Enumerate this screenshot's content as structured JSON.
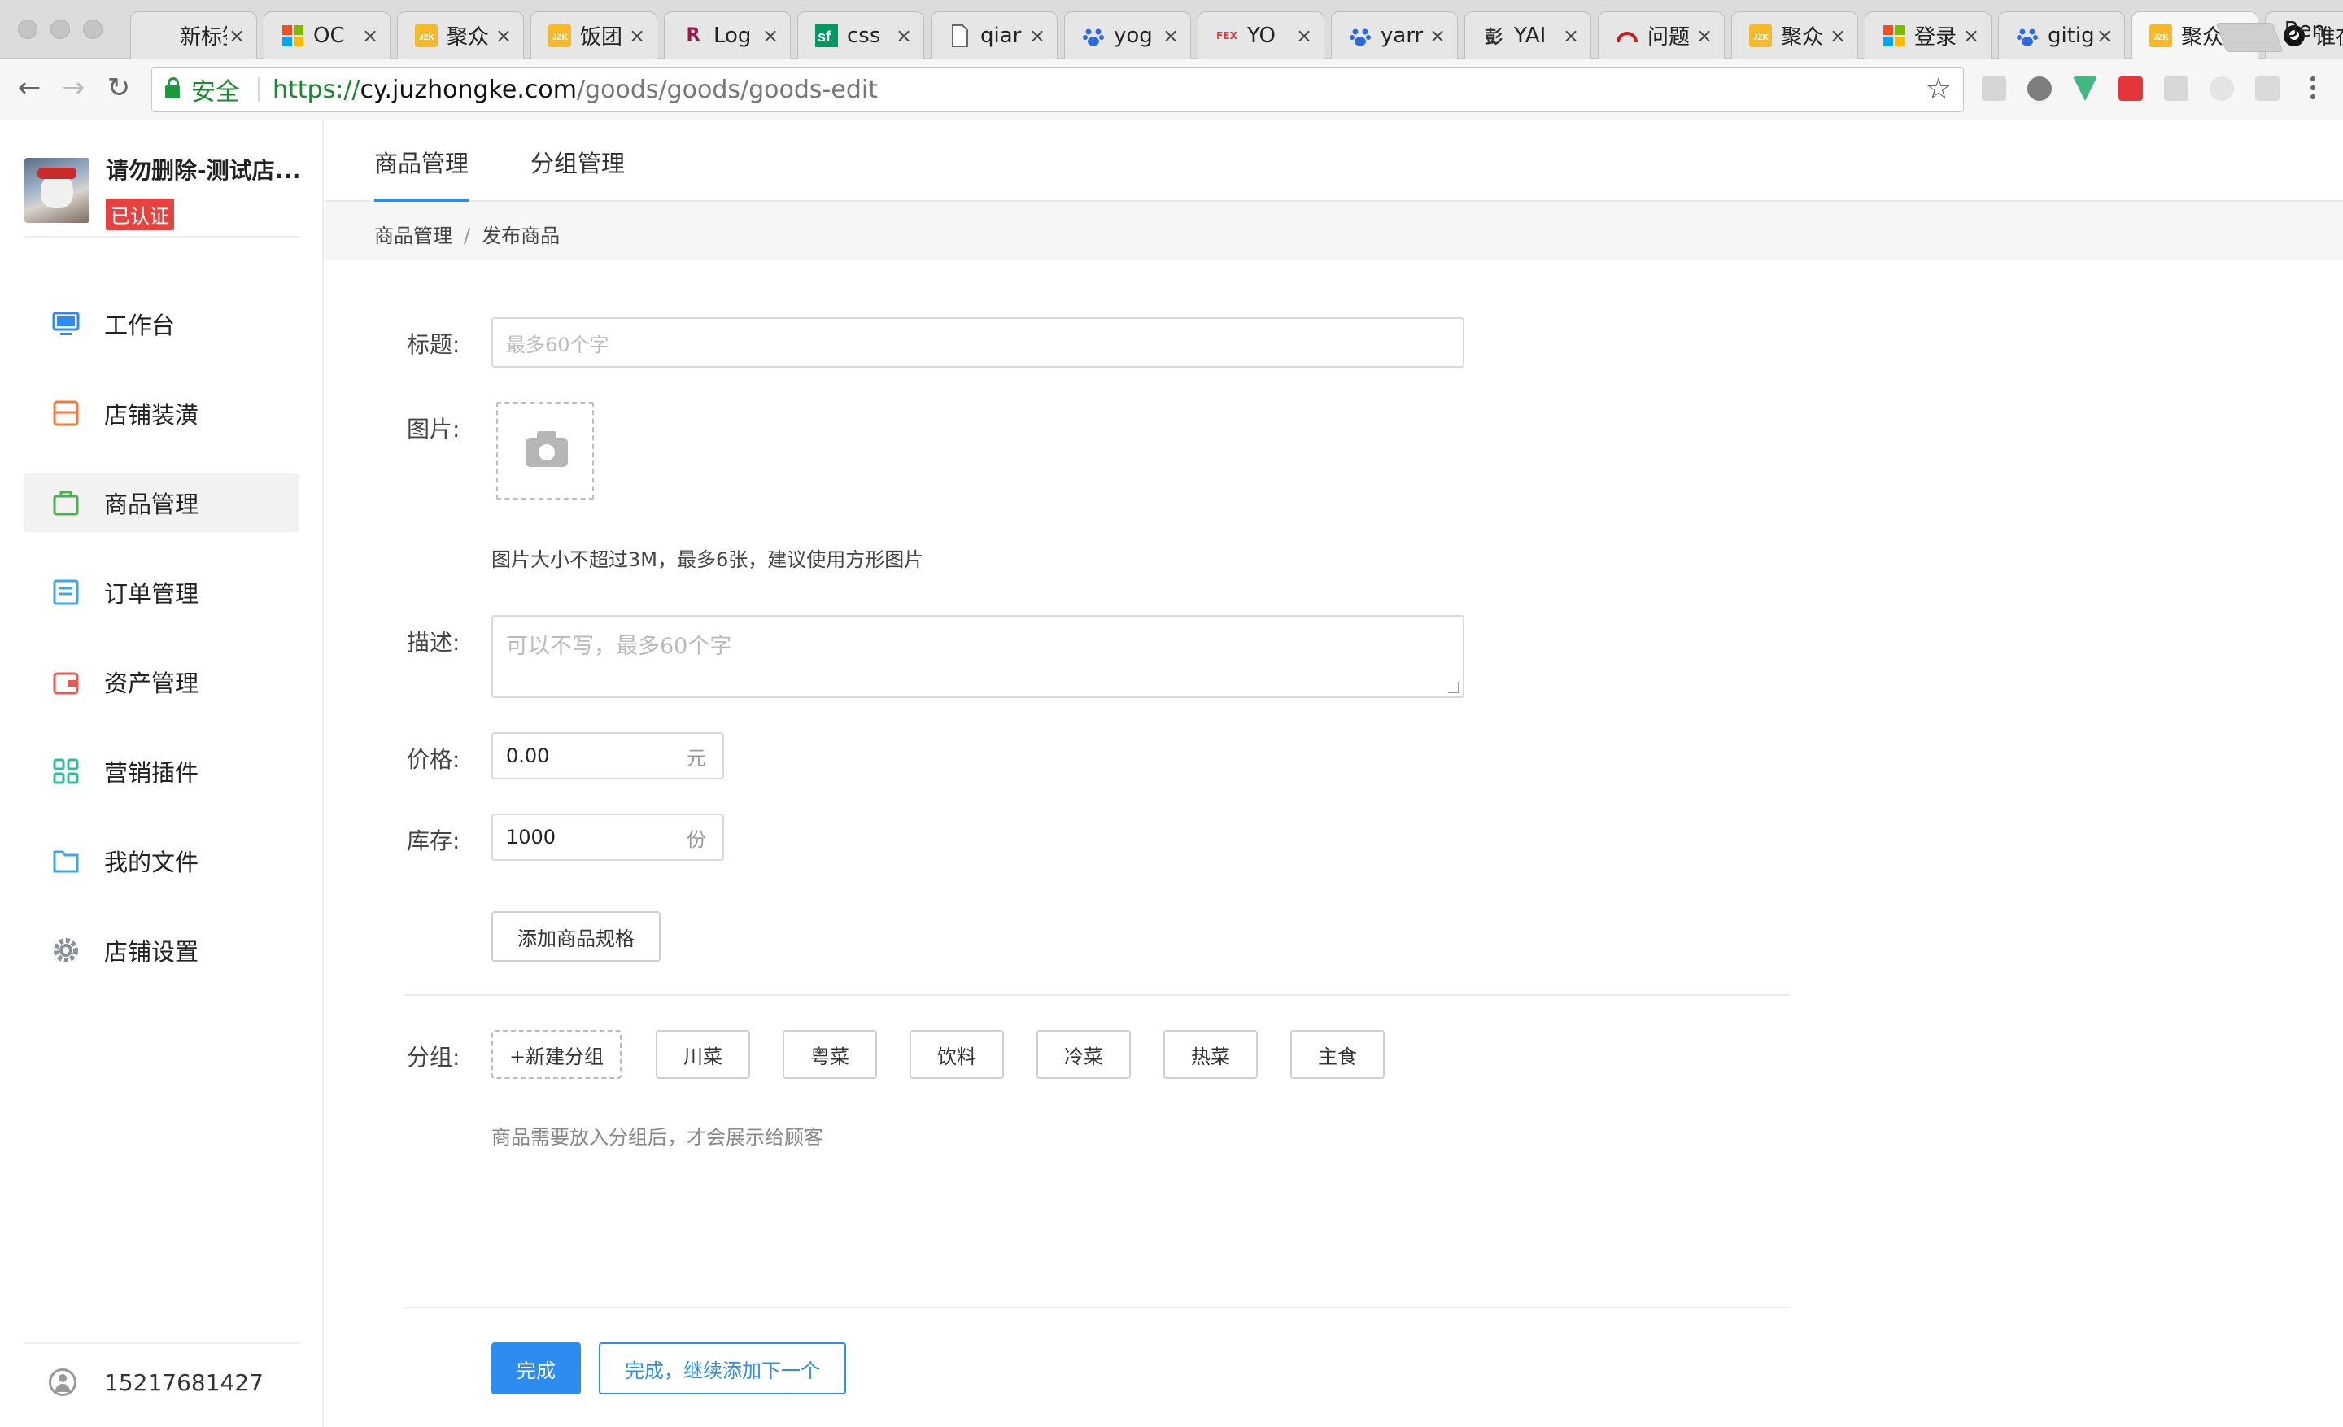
{
  "browser": {
    "tabs": [
      {
        "title": "新标签页",
        "icon": "blank-icon",
        "color": "#cccccc"
      },
      {
        "title": "OC",
        "icon": "microsoft-icon",
        "color": "#f25022"
      },
      {
        "title": "聚众",
        "icon": "juzhong-icon",
        "color": "#f5b92a"
      },
      {
        "title": "饭团",
        "icon": "juzhong-icon",
        "color": "#f5b92a"
      },
      {
        "title": "Log",
        "icon": "r-icon",
        "color": "#a3154a"
      },
      {
        "title": "css",
        "icon": "sf-icon",
        "color": "#009a61"
      },
      {
        "title": "qiar",
        "icon": "document-icon",
        "color": "#666666"
      },
      {
        "title": "yog",
        "icon": "baidu-icon",
        "color": "#2d6ae0"
      },
      {
        "title": "YO",
        "icon": "fex-icon",
        "color": "#e6343b"
      },
      {
        "title": "yarr",
        "icon": "baidu-icon",
        "color": "#2d6ae0"
      },
      {
        "title": "YAI",
        "icon": "calligraphy-icon",
        "color": "#333333"
      },
      {
        "title": "问题",
        "icon": "arc-icon",
        "color": "#c81e1e"
      },
      {
        "title": "聚众",
        "icon": "juzhong-icon",
        "color": "#f5b92a"
      },
      {
        "title": "登录",
        "icon": "microsoft-icon",
        "color": "#f25022"
      },
      {
        "title": "gitig",
        "icon": "baidu-icon",
        "color": "#2d6ae0"
      },
      {
        "title": "聚众",
        "icon": "juzhong-icon",
        "color": "#f5b92a"
      },
      {
        "title": "谁在",
        "icon": "github-icon",
        "color": "#111111"
      }
    ],
    "active_tab_index": 15,
    "profile_name": "Ben",
    "security_label": "安全",
    "url": {
      "protocol": "https://",
      "host": "cy.juzhongke.com",
      "path": "/goods/goods/goods-edit"
    }
  },
  "shop": {
    "name": "请勿删除-测试店...",
    "verified_label": "已认证"
  },
  "sidebar": {
    "items": [
      {
        "label": "工作台",
        "icon": "monitor-icon",
        "color": "#2d8cf0"
      },
      {
        "label": "店铺装潢",
        "icon": "store-icon",
        "color": "#f47a3a"
      },
      {
        "label": "商品管理",
        "icon": "bag-icon",
        "color": "#4caf50",
        "active": true
      },
      {
        "label": "订单管理",
        "icon": "list-icon",
        "color": "#3ba7e8"
      },
      {
        "label": "资产管理",
        "icon": "wallet-icon",
        "color": "#e85a4f"
      },
      {
        "label": "营销插件",
        "icon": "grid-icon",
        "color": "#2bbf9a"
      },
      {
        "label": "我的文件",
        "icon": "folder-icon",
        "color": "#3ba7e8"
      },
      {
        "label": "店铺设置",
        "icon": "gear-icon",
        "color": "#8a8f99"
      }
    ],
    "user_phone": "15217681427"
  },
  "topnav": {
    "tabs": [
      "商品管理",
      "分组管理"
    ],
    "active": 0
  },
  "breadcrumb": {
    "items": [
      "商品管理",
      "发布商品"
    ],
    "separator": "/"
  },
  "form": {
    "title": {
      "label": "标题:",
      "placeholder": "最多60个字",
      "value": ""
    },
    "image": {
      "label": "图片:",
      "hint": "图片大小不超过3M，最多6张，建议使用方形图片"
    },
    "description": {
      "label": "描述:",
      "placeholder": "可以不写，最多60个字",
      "value": ""
    },
    "price": {
      "label": "价格:",
      "value": "0.00",
      "unit": "元"
    },
    "stock": {
      "label": "库存:",
      "value": "1000",
      "unit": "份"
    },
    "add_spec_label": "添加商品规格",
    "group": {
      "label": "分组:",
      "new_label": "+新建分组",
      "options": [
        "川菜",
        "粤菜",
        "饮料",
        "冷菜",
        "热菜",
        "主食"
      ],
      "hint": "商品需要放入分组后，才会展示给顾客"
    },
    "submit_label": "完成",
    "submit_next_label": "完成，继续添加下一个"
  },
  "colors": {
    "primary": "#2d8cf0",
    "verified_badge": "#e64340"
  }
}
